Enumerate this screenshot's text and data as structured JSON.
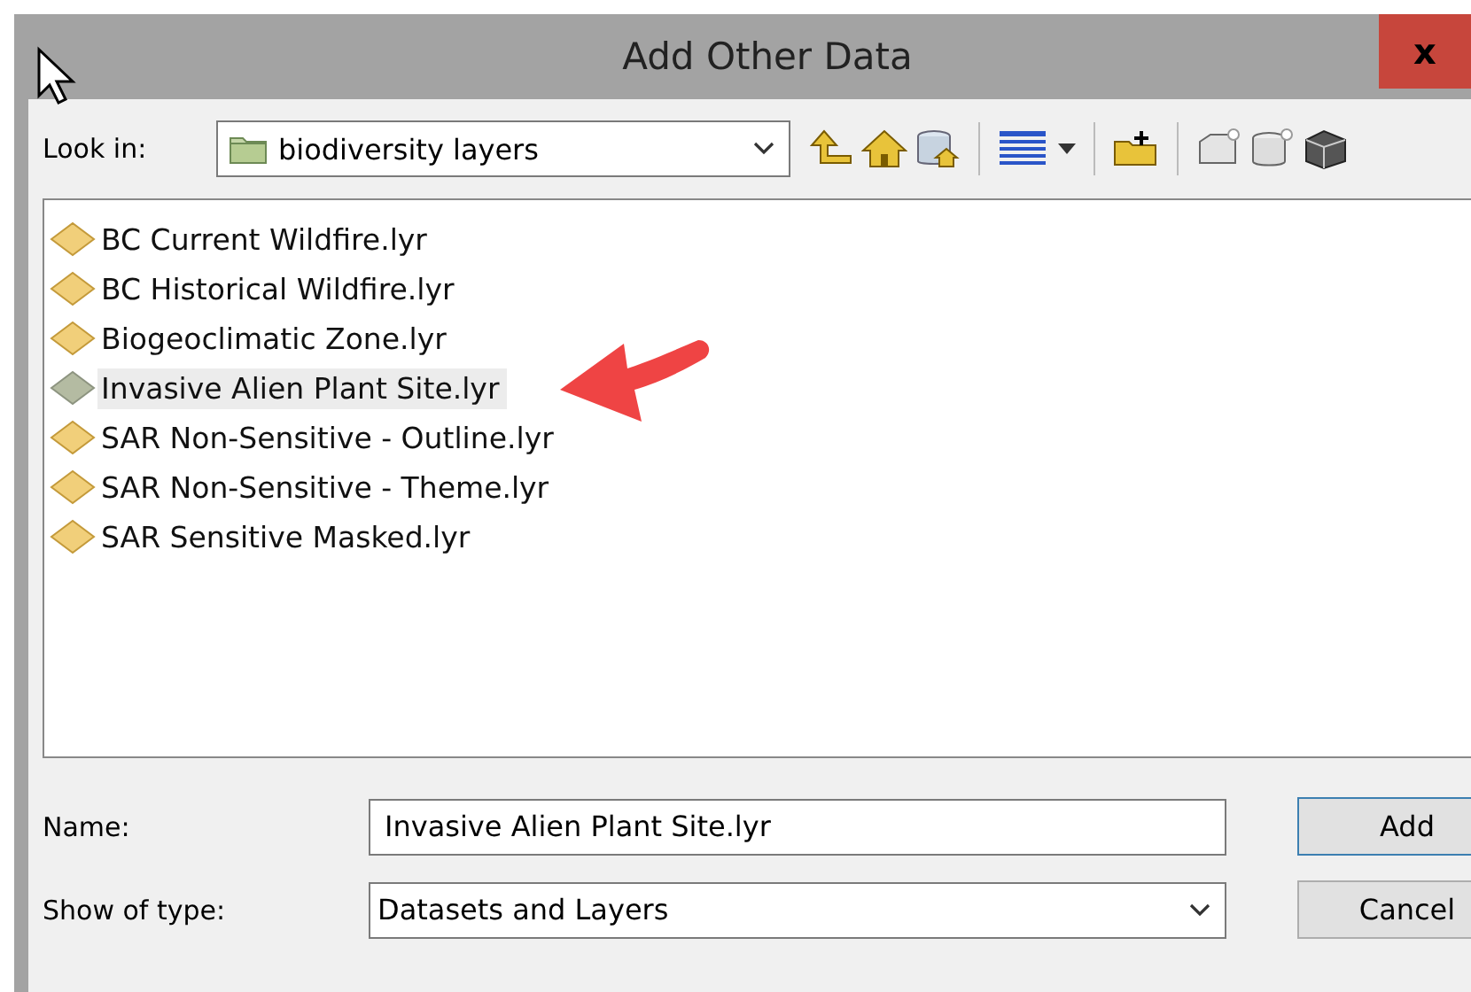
{
  "window": {
    "title": "Add Other Data",
    "close": "x"
  },
  "look_in": {
    "label": "Look in:",
    "value": "biodiversity layers"
  },
  "files": [
    {
      "name": "BC Current Wildfire.lyr",
      "selected": false
    },
    {
      "name": "BC Historical Wildfire.lyr",
      "selected": false
    },
    {
      "name": "Biogeoclimatic Zone.lyr",
      "selected": false
    },
    {
      "name": "Invasive Alien Plant Site.lyr",
      "selected": true
    },
    {
      "name": "SAR Non-Sensitive - Outline.lyr",
      "selected": false
    },
    {
      "name": "SAR Non-Sensitive - Theme.lyr",
      "selected": false
    },
    {
      "name": "SAR Sensitive Masked.lyr",
      "selected": false
    }
  ],
  "name_field": {
    "label": "Name:",
    "value": "Invasive Alien Plant Site.lyr"
  },
  "type_field": {
    "label": "Show of type:",
    "value": "Datasets and Layers"
  },
  "buttons": [
    {
      "label": "Add",
      "kind": "default"
    },
    {
      "label": "Cancel",
      "kind": "normal"
    }
  ]
}
